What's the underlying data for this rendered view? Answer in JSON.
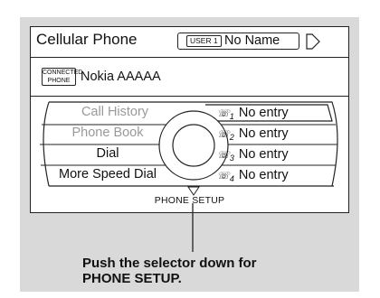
{
  "screen": {
    "title": "Cellular Phone",
    "user_badge": "USER 1",
    "user_name": "No Name",
    "connected_badge_line1": "CONNECTED",
    "connected_badge_line2": "PHONE",
    "connected_phone": "Nokia AAAAA",
    "menu": [
      {
        "label": "Call History",
        "dim": true
      },
      {
        "label": "Phone Book",
        "dim": true
      },
      {
        "label": "Dial",
        "dim": false
      },
      {
        "label": "More Speed Dial",
        "dim": false
      }
    ],
    "speed_dial": [
      {
        "index": "1",
        "label": "No entry"
      },
      {
        "index": "2",
        "label": "No entry"
      },
      {
        "index": "3",
        "label": "No entry"
      },
      {
        "index": "4",
        "label": "No entry"
      }
    ],
    "footer": "PHONE SETUP"
  },
  "caption": {
    "line1": "Push the selector down for",
    "line2": "PHONE SETUP."
  },
  "colors": {
    "panel_bg": "#d9d9d9",
    "screen_bg": "#ffffff",
    "dim_text": "#9a9a9a"
  }
}
